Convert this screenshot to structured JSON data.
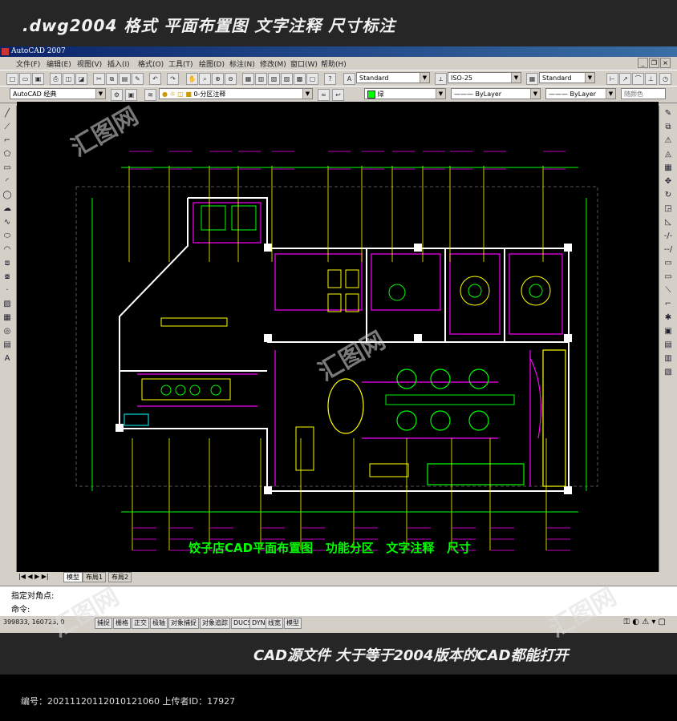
{
  "top_banner": ".dwg2004 格式  平面布置图 文字注释 尺寸标注",
  "app_title": "AutoCAD 2007",
  "menu": [
    "文件(F)",
    "编辑(E)",
    "视图(V)",
    "插入(I)",
    "格式(O)",
    "工具(T)",
    "绘图(D)",
    "标注(N)",
    "修改(M)",
    "窗口(W)",
    "帮助(H)"
  ],
  "toolbar": {
    "text_style": "Standard",
    "dim_style": "ISO-25",
    "table_style": "Standard",
    "workspace": "AutoCAD 经典",
    "layer": "0-分区注释",
    "color": "绿",
    "linetype": "ByLayer",
    "lineweight": "ByLayer",
    "plotstyle": "随颜色"
  },
  "drawing": {
    "caption": "饺子店CAD平面布置图   功能分区   文字注释   尺寸"
  },
  "layout_tabs": [
    "模型",
    "布局1",
    "布局2"
  ],
  "command": {
    "line1": "指定对角点:",
    "line2": "命令:"
  },
  "status": {
    "coords": "399833, 160723, 0",
    "buttons": [
      "捕捉",
      "栅格",
      "正交",
      "极轴",
      "对象捕捉",
      "对象追踪",
      "DUCS",
      "DYN",
      "线宽",
      "模型"
    ]
  },
  "bottom_banner": "CAD源文件  大于等于2004版本的CAD都能打开",
  "footer_text": "编号：20211120112010121060 上传者ID：17927",
  "watermark": "汇图网",
  "colors": {
    "bg_dark": "#262626",
    "cad_canvas": "#000000",
    "wall": "#ffffff",
    "magenta": "#ff00ff",
    "green": "#00ff00",
    "yellow": "#ffff00",
    "cyan": "#00ffff",
    "caption": "#00ff00"
  }
}
